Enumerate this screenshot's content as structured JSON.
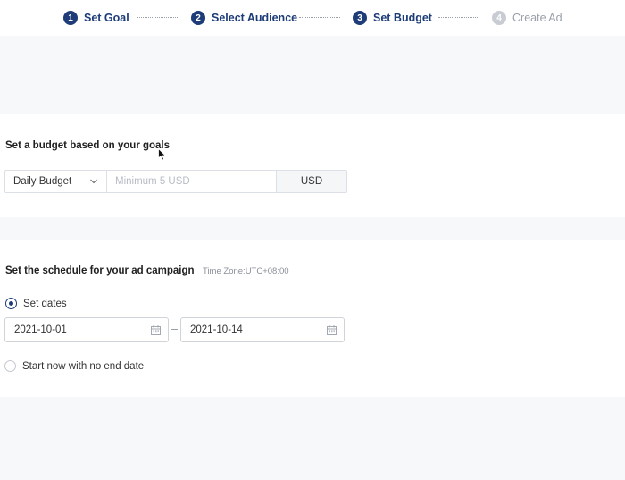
{
  "stepper": {
    "steps": [
      {
        "num": "1",
        "label": "Set Goal"
      },
      {
        "num": "2",
        "label": "Select Audience"
      },
      {
        "num": "3",
        "label": "Set Budget"
      },
      {
        "num": "4",
        "label": "Create Ad"
      }
    ],
    "current_step": 3
  },
  "budget": {
    "title": "Set a budget based on your goals",
    "type_select": "Daily Budget",
    "amount_placeholder": "Minimum 5 USD",
    "currency": "USD"
  },
  "schedule": {
    "title": "Set the schedule for your ad campaign",
    "timezone": "Time Zone:UTC+08:00",
    "set_dates_label": "Set dates",
    "start_date": "2021-10-01",
    "end_date": "2021-10-14",
    "no_end_label": "Start now with no end date"
  },
  "colors": {
    "accent": "#1d3c78",
    "inactive": "#c9ccd3"
  }
}
